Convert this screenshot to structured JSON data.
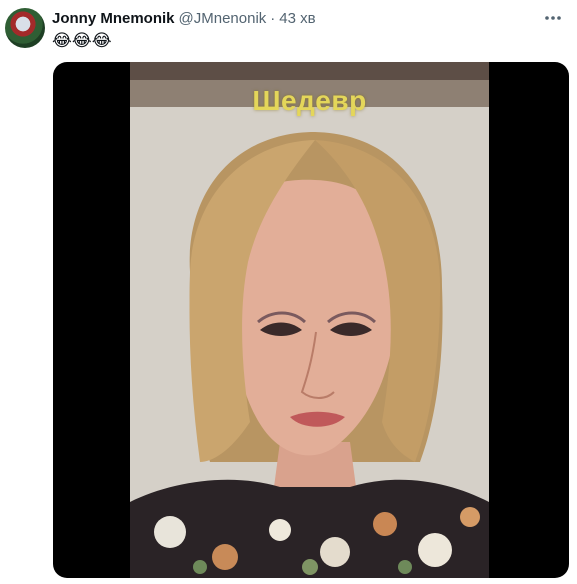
{
  "tweet": {
    "author_name": "Jonny Mnemonik",
    "handle": "@JMnenonik",
    "separator": "·",
    "time": "43 хв",
    "text": "😂😂😂",
    "more_icon": "more-dots-icon",
    "avatar_icon": "avatar"
  },
  "media": {
    "overlay_caption": "Шедевр"
  }
}
